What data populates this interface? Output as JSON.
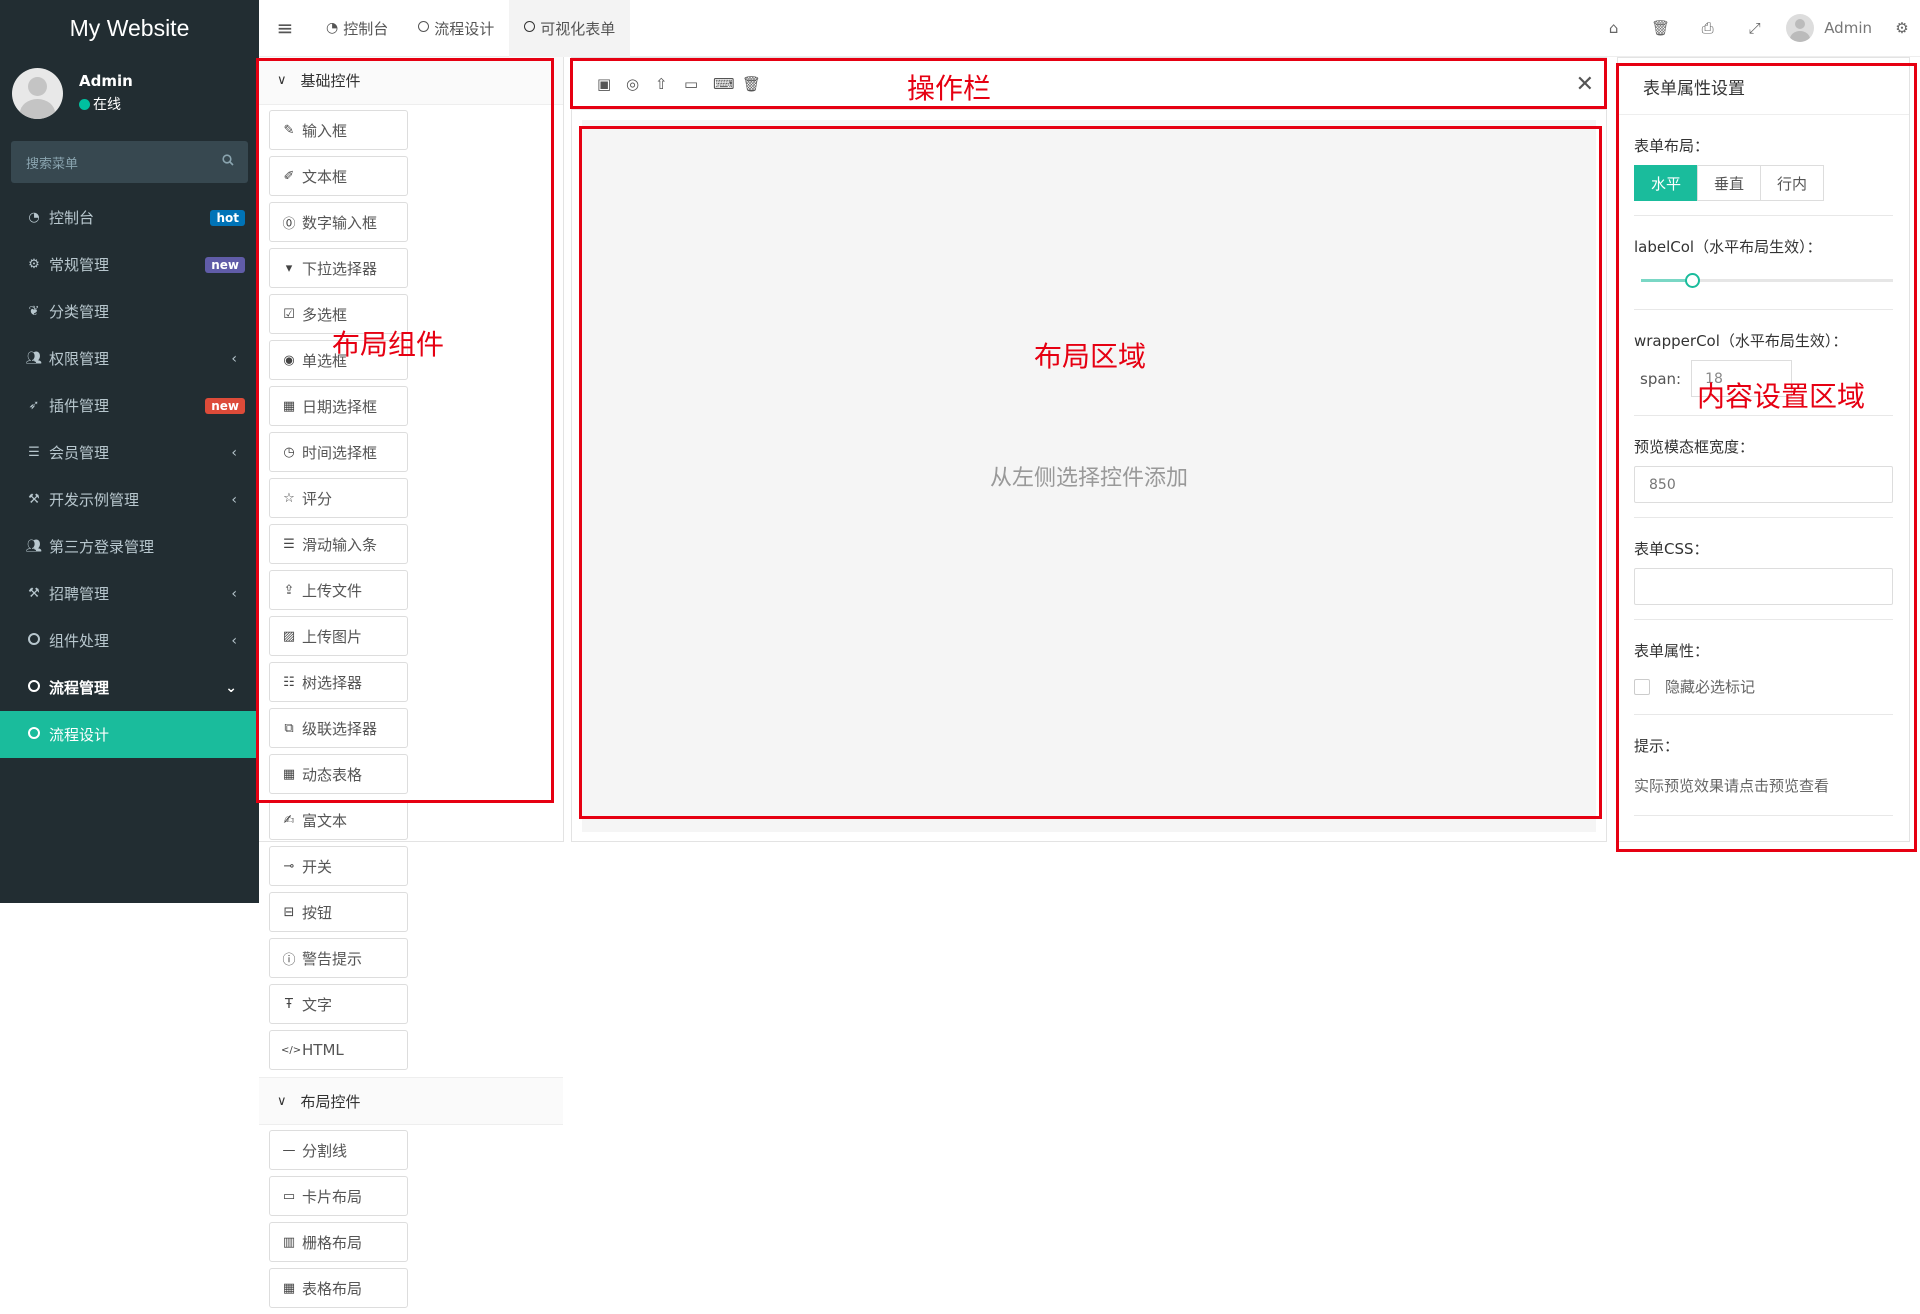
{
  "app": {
    "brand": "My Website"
  },
  "user": {
    "name": "Admin",
    "status": "在线"
  },
  "search": {
    "placeholder": "搜索菜单"
  },
  "sidebar": {
    "items": [
      {
        "label": "控制台",
        "icon": "dashboard-icon",
        "badge": "hot",
        "badge_color": "#0073b7"
      },
      {
        "label": "常规管理",
        "icon": "cogs-icon",
        "badge": "new",
        "badge_color": "#605ca8"
      },
      {
        "label": "分类管理",
        "icon": "leaf-icon"
      },
      {
        "label": "权限管理",
        "icon": "group-icon",
        "arrow": "‹"
      },
      {
        "label": "插件管理",
        "icon": "rocket-icon",
        "badge": "new",
        "badge_color": "#dd4b39"
      },
      {
        "label": "会员管理",
        "icon": "list-icon",
        "arrow": "‹"
      },
      {
        "label": "开发示例管理",
        "icon": "magic-icon",
        "arrow": "‹"
      },
      {
        "label": "第三方登录管理",
        "icon": "users-icon"
      },
      {
        "label": "招聘管理",
        "icon": "magic-icon",
        "arrow": "‹"
      },
      {
        "label": "组件处理",
        "icon": "circle-icon",
        "arrow": "‹"
      },
      {
        "label": "流程管理",
        "icon": "circle-icon",
        "arrow": "⌄"
      },
      {
        "label": "流程设计",
        "icon": "circle-icon"
      }
    ]
  },
  "topbar": {
    "tabs": [
      {
        "label": "控制台",
        "icon": "dashboard-icon"
      },
      {
        "label": "流程设计",
        "icon": "circle-icon"
      },
      {
        "label": "可视化表单",
        "icon": "circle-icon"
      }
    ],
    "user": "Admin"
  },
  "left_panel": {
    "basic_title": "基础控件",
    "basic": [
      "输入框",
      "文本框",
      "数字输入框",
      "下拉选择器",
      "多选框",
      "单选框",
      "日期选择框",
      "时间选择框",
      "评分",
      "滑动输入条",
      "上传文件",
      "上传图片",
      "树选择器",
      "级联选择器",
      "动态表格",
      "富文本",
      "开关",
      "按钮",
      "警告提示",
      "文字",
      "HTML"
    ],
    "layout_title": "布局控件",
    "layout": [
      "分割线",
      "卡片布局",
      "栅格布局",
      "表格布局"
    ]
  },
  "canvas": {
    "empty_hint": "从左侧选择控件添加"
  },
  "right_panel": {
    "title": "表单属性设置",
    "layout_label": "表单布局：",
    "layout_options": [
      "水平",
      "垂直",
      "行内"
    ],
    "layout_selected": "水平",
    "labelcol_label": "labelCol（水平布局生效）：",
    "labelcol_value_fraction": 0.2,
    "wrappercol_label": "wrapperCol（水平布局生效）：",
    "span_label": "span:",
    "span_value": "18",
    "modal_width_label": "预览模态框宽度：",
    "modal_width_value": "850",
    "css_label": "表单CSS：",
    "css_value": "",
    "props_label": "表单属性：",
    "hide_required_label": "隐藏必选标记",
    "tip_label": "提示：",
    "tip_text": "实际预览效果请点击预览查看"
  },
  "annotations": {
    "layout_components": "布局组件",
    "toolbar": "操作栏",
    "layout_area": "布局区域",
    "content_settings": "内容设置区域",
    "color": "#e60012"
  },
  "colors": {
    "sidebar_bg": "#222d32",
    "accent": "#1abc9c"
  }
}
